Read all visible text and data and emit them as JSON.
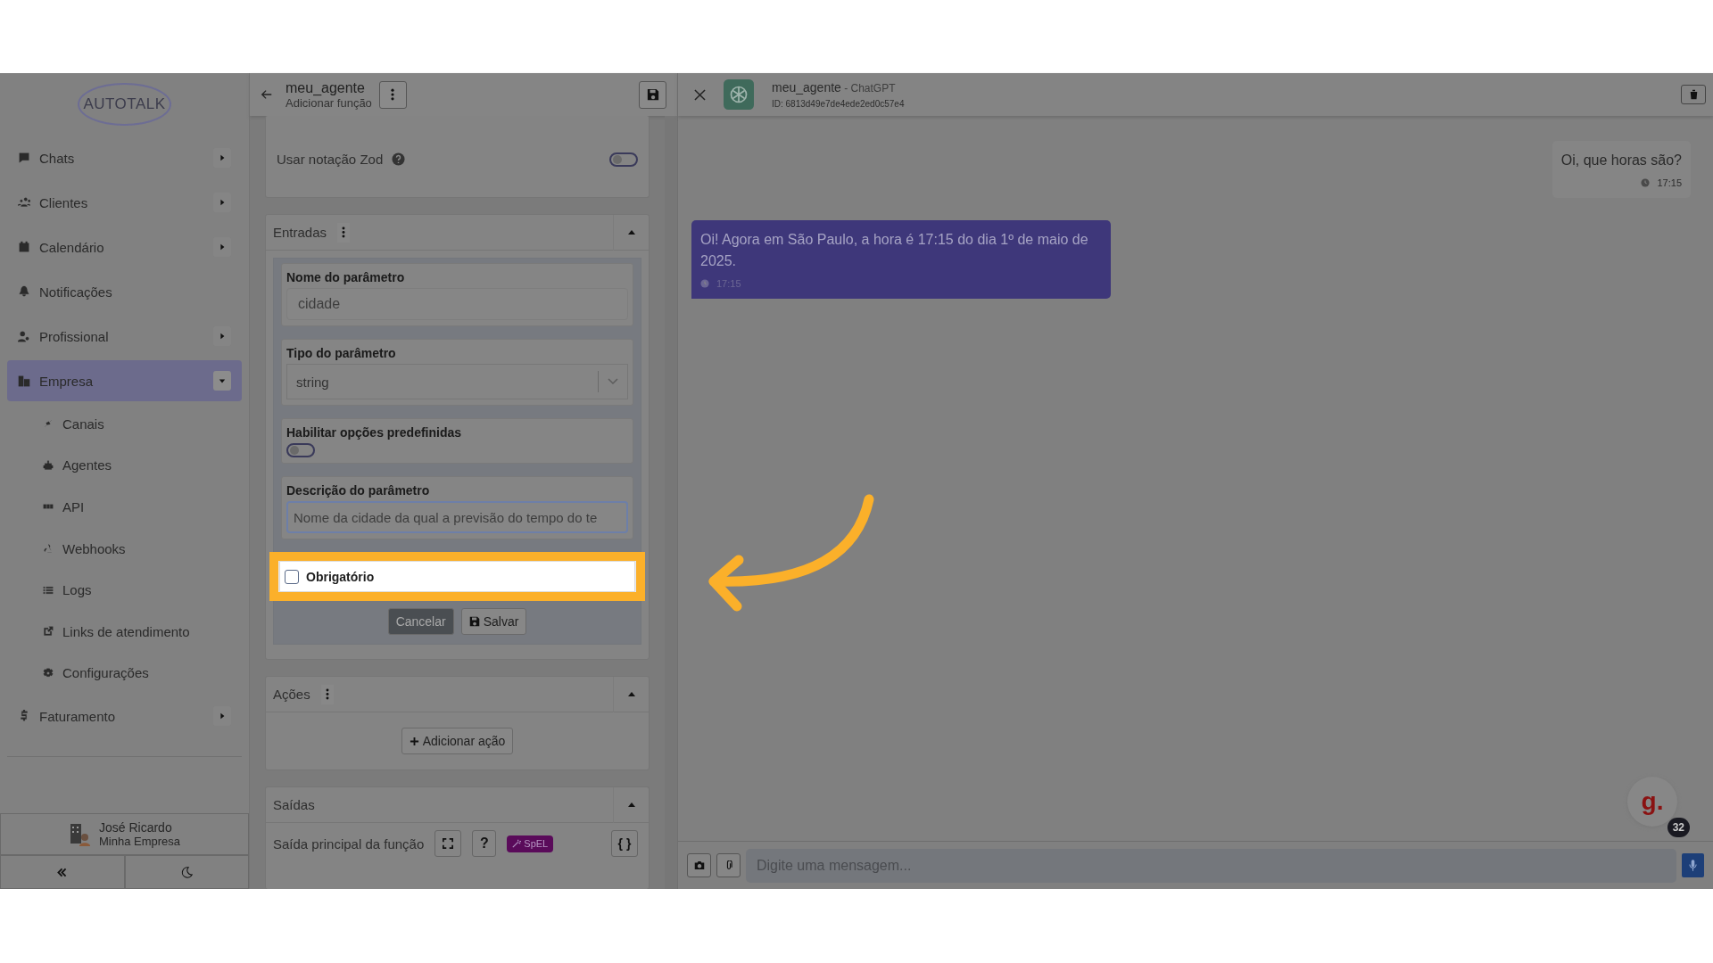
{
  "sidebar": {
    "logo": "AUTOTALK",
    "items": [
      {
        "label": "Chats",
        "selected": false,
        "expanded": false
      },
      {
        "label": "Clientes",
        "selected": false,
        "expanded": false
      },
      {
        "label": "Calendário",
        "selected": false,
        "expanded": false
      },
      {
        "label": "Notificações",
        "selected": false
      },
      {
        "label": "Profissional",
        "selected": false,
        "expanded": false
      },
      {
        "label": "Empresa",
        "selected": true,
        "expanded": true,
        "children": [
          {
            "label": "Canais",
            "selected": false
          },
          {
            "label": "Agentes",
            "selected": false
          },
          {
            "label": "API",
            "selected": false
          },
          {
            "label": "Webhooks",
            "selected": false
          },
          {
            "label": "Logs",
            "selected": false
          },
          {
            "label": "Links de atendimento",
            "selected": false
          },
          {
            "label": "Configurações",
            "selected": false
          }
        ]
      },
      {
        "label": "Faturamento",
        "selected": false,
        "expanded": false
      }
    ],
    "user": {
      "name": "José Ricardo",
      "company": "Minha Empresa"
    }
  },
  "editor": {
    "title": "meu_agente",
    "subtitle": "Adicionar função",
    "zod": {
      "label": "Usar notação Zod",
      "on": false
    },
    "inputs": {
      "title": "Entradas",
      "expanded": true,
      "name_label": "Nome do parâmetro",
      "name_value": "cidade",
      "type_label": "Tipo do parâmetro",
      "type_value": "string",
      "options_label": "Habilitar opções predefinidas",
      "options_on": false,
      "desc_label": "Descrição do parâmetro",
      "desc_value": "Nome da cidade da qual a previsão do tempo do te",
      "required_label": "Obrigatório",
      "required_checked": false,
      "cancel": "Cancelar",
      "save": "Salvar"
    },
    "actions": {
      "title": "Ações",
      "expanded": true,
      "add": "Adicionar ação"
    },
    "outputs": {
      "title": "Saídas",
      "expanded": true,
      "main_label": "Saída principal da função",
      "help": "?",
      "badge": "SpEL",
      "code": "{ }"
    }
  },
  "chat": {
    "name": "meu_agente",
    "model": " - ChatGPT",
    "id": "ID: 6813d49e7de4ede2ed0c57e4",
    "messages": [
      {
        "kind": "sent",
        "text": "Oi, que horas são?",
        "time": "17:15"
      },
      {
        "kind": "received",
        "text": "Oi! Agora em São Paulo, a hora é 17:15 do dia 1º de maio de 2025.",
        "time": "17:15"
      }
    ],
    "input_placeholder": "Digite uma mensagem...",
    "widget": {
      "label": "g.",
      "count": "32"
    }
  }
}
